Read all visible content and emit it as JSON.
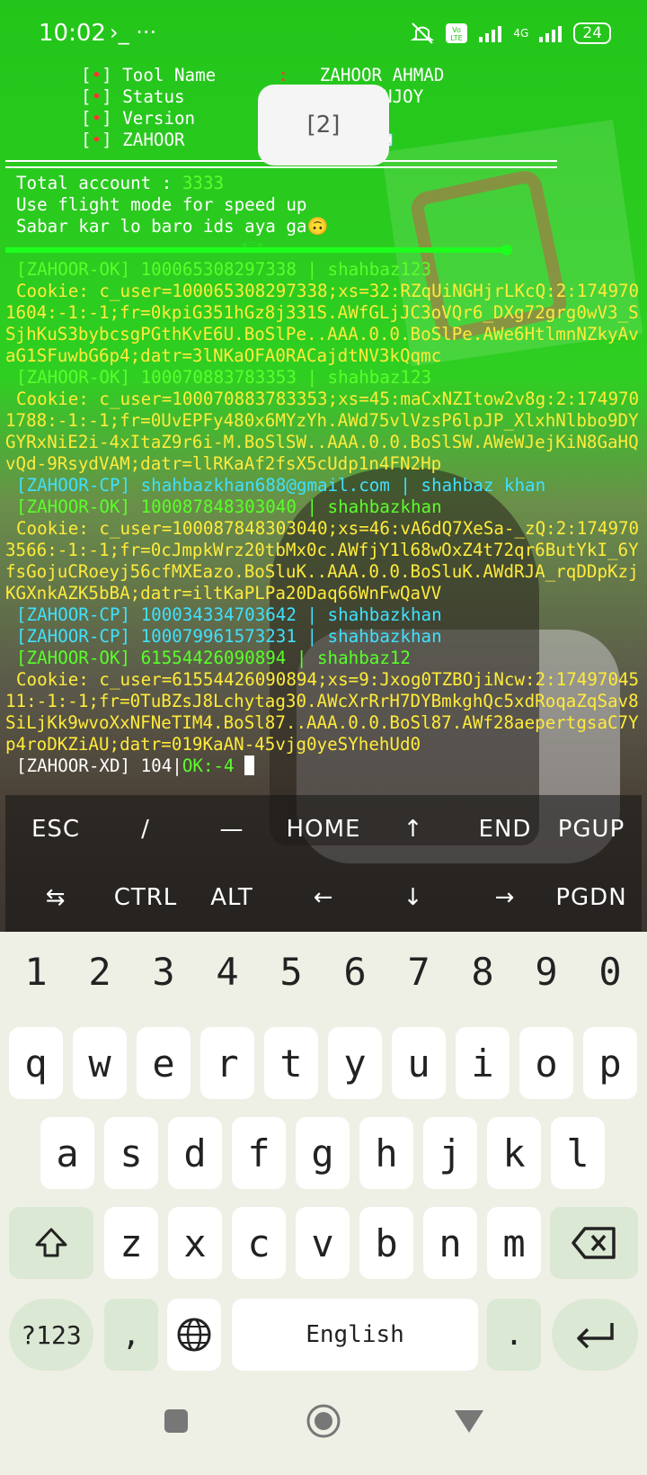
{
  "status_bar": {
    "time": "10:02",
    "extras": "›_ ···",
    "battery": "24",
    "net": "4G"
  },
  "header_lines": [
    {
      "bullet": "•",
      "label": "Tool Name",
      "sep": ":",
      "value": "ZAHOOR AHMAD"
    },
    {
      "bullet": "•",
      "label": "Status",
      "sep": "",
      "value": "+ ENJOY"
    },
    {
      "bullet": "•",
      "label": "Version",
      "sep": "",
      "value": ""
    },
    {
      "bullet": "•",
      "label": "ZAHOOR",
      "sep": "",
      "value": "🔥💌"
    }
  ],
  "popup": {
    "text": "[2]"
  },
  "info": {
    "total_label": "Total account : ",
    "total_value": "3333",
    "flight_tip": "Use flight mode for speed up",
    "wait_tip": "Sabar kar lo baro ids aya ga🙃"
  },
  "progress_mid": "⇧♡⇧",
  "log": [
    {
      "type": "ok",
      "text": "[ZAHOOR-OK] 100065308297338 | shahbaz123"
    },
    {
      "type": "cookie",
      "text": "Cookie: c_user=100065308297338;xs=32:RZqUiNGHjrLKcQ:2:1749701604:-1:-1;fr=0kpiG351hGz8j331S.AWfGLjJC3oVQr6_DXg72grg0wV3_SSjhKuS3bybcsgPGthKvE6U.BoSlPe..AAA.0.0.BoSlPe.AWe6HtlmnNZkyAvaG1SFuwbG6p4;datr=3lNKaOFA0RACajdtNV3kQqmc"
    },
    {
      "type": "ok",
      "text": "[ZAHOOR-OK] 100070883783353 | shahbaz123"
    },
    {
      "type": "cookie",
      "text": "Cookie: c_user=100070883783353;xs=45:maCxNZItow2v8g:2:1749701788:-1:-1;fr=0UvEPFy480x6MYzYh.AWd75vlVzsP6lpJP_XlxhNlbbo9DYGYRxNiE2i-4xItaZ9r6i-M.BoSlSW..AAA.0.0.BoSlSW.AWeWJejKiN8GaHQvQd-9RsydVAM;datr=llRKaAf2fsX5cUdp1n4FN2Hp"
    },
    {
      "type": "cp",
      "text": "[ZAHOOR-CP] shahbazkhan688@gmail.com | shahbaz khan"
    },
    {
      "type": "ok",
      "text": "[ZAHOOR-OK] 100087848303040 | shahbazkhan"
    },
    {
      "type": "cookie",
      "text": "Cookie: c_user=100087848303040;xs=46:vA6dQ7XeSa-_zQ:2:1749703566:-1:-1;fr=0cJmpkWrz20tbMx0c.AWfjY1l68wOxZ4t72qr6ButYkI_6YfsGojuCRoeyj56cfMXEazo.BoSluK..AAA.0.0.BoSluK.AWdRJA_rqDDpKzjKGXnkAZK5bBA;datr=iltKaPLPa20Daq66WnFwQaVV"
    },
    {
      "type": "cp",
      "text": "[ZAHOOR-CP] 100034334703642 | shahbazkhan"
    },
    {
      "type": "cp",
      "text": "[ZAHOOR-CP] 100079961573231 | shahbazkhan"
    },
    {
      "type": "ok",
      "text": "[ZAHOOR-OK] 61554426090894 | shahbaz12"
    },
    {
      "type": "cookie",
      "text": "Cookie: c_user=61554426090894;xs=9:Jxog0TZBOjiNcw:2:1749704511:-1:-1;fr=0TuBZsJ8Lchytag30.AWcXrRrH7DYBmkghQc5xdRoqaZqSav8SiLjKk9wvoXxNFNeTIM4.BoSl87..AAA.0.0.BoSl87.AWf28aepertgsaC7Yp4roDKZiAU;datr=019KaAN-45vjg0yeSYhehUd0"
    }
  ],
  "prompt": {
    "label": "[ZAHOOR-XD] 104|",
    "ok": "OK:-4"
  },
  "extra_keys": {
    "row1": [
      "ESC",
      "/",
      "—",
      "HOME",
      "↑",
      "END",
      "PGUP"
    ],
    "row2": [
      "⇆",
      "CTRL",
      "ALT",
      "←",
      "↓",
      "→",
      "PGDN"
    ]
  },
  "keyboard": {
    "numbers": [
      "1",
      "2",
      "3",
      "4",
      "5",
      "6",
      "7",
      "8",
      "9",
      "0"
    ],
    "row1": [
      "q",
      "w",
      "e",
      "r",
      "t",
      "y",
      "u",
      "i",
      "o",
      "p"
    ],
    "row2": [
      "a",
      "s",
      "d",
      "f",
      "g",
      "h",
      "j",
      "k",
      "l"
    ],
    "row3": [
      "z",
      "x",
      "c",
      "v",
      "b",
      "n",
      "m"
    ],
    "sym_label": "?123",
    "comma": ",",
    "space_label": "English",
    "period": "."
  },
  "icons": [
    "mute-icon",
    "volte-icon",
    "signal-icon",
    "battery-icon",
    "shift-icon",
    "backspace-icon",
    "globe-icon",
    "enter-icon",
    "recents-icon",
    "home-icon",
    "back-icon"
  ]
}
